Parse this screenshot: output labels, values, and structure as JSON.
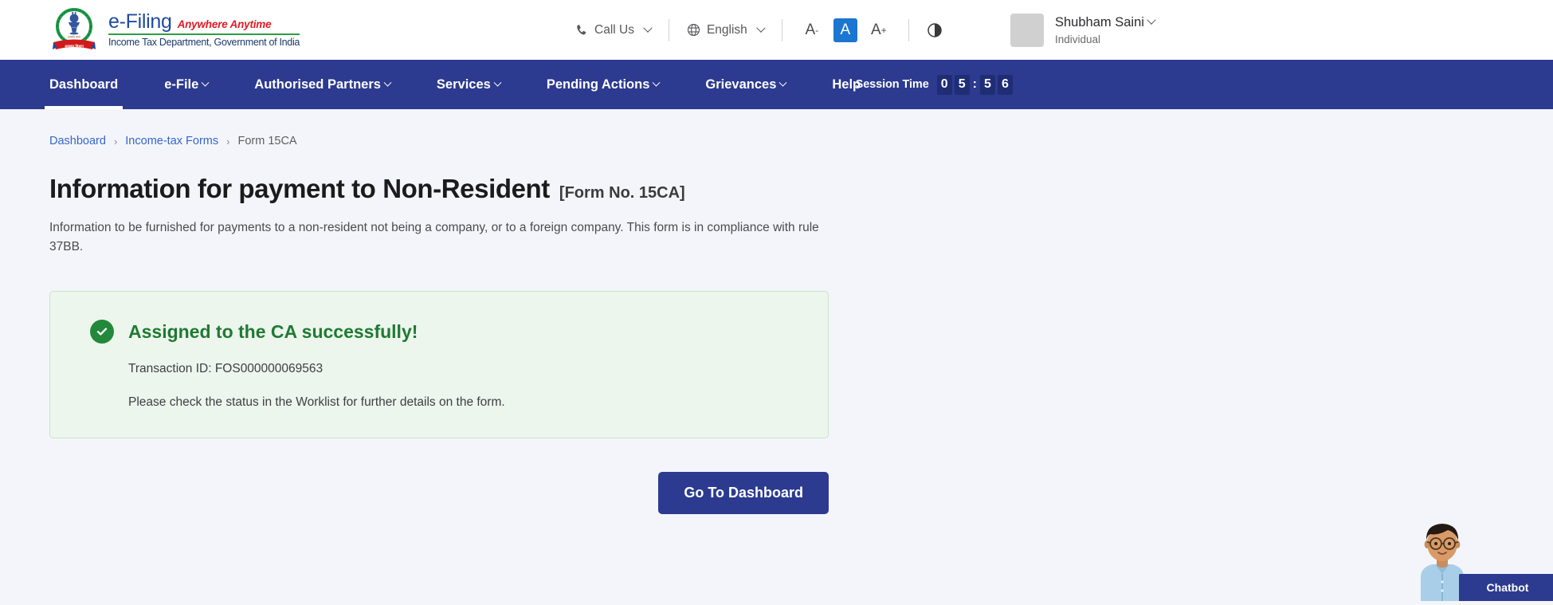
{
  "header": {
    "brand": {
      "emblem_alt": "india-emblem-income-tax",
      "title": "e-Filing",
      "tagline": "Anywhere Anytime",
      "department": "Income Tax Department, Government of India"
    },
    "tools": {
      "call_us": "Call Us",
      "language": "English",
      "font_decrease": "A",
      "font_decrease_sup": "-",
      "font_normal": "A",
      "font_increase": "A",
      "font_increase_sup": "+",
      "contrast_title": "contrast"
    },
    "user": {
      "name": "Shubham Saini",
      "role": "Individual"
    }
  },
  "nav": {
    "items": [
      {
        "label": "Dashboard",
        "has_caret": false,
        "active": true
      },
      {
        "label": "e-File",
        "has_caret": true,
        "active": false
      },
      {
        "label": "Authorised Partners",
        "has_caret": true,
        "active": false
      },
      {
        "label": "Services",
        "has_caret": true,
        "active": false
      },
      {
        "label": "Pending Actions",
        "has_caret": true,
        "active": false
      },
      {
        "label": "Grievances",
        "has_caret": true,
        "active": false
      },
      {
        "label": "Help",
        "has_caret": false,
        "active": false
      }
    ],
    "session": {
      "label": "Session Time",
      "d1": "0",
      "d2": "5",
      "colon": ":",
      "d3": "5",
      "d4": "6"
    }
  },
  "breadcrumb": {
    "item1": "Dashboard",
    "sep1": "›",
    "item2": "Income-tax Forms",
    "sep2": "›",
    "current": "Form 15CA"
  },
  "page": {
    "title": "Information for payment to Non-Resident",
    "form_no": "[Form No. 15CA]",
    "description": "Information to be furnished for payments to a non-resident not being a company, or to a foreign company. This form is in compliance with rule 37BB."
  },
  "success": {
    "title": "Assigned to the CA successfully!",
    "transaction_line": "Transaction ID: FOS000000069563",
    "status_line": "Please check the status in the Worklist for further details on the form."
  },
  "actions": {
    "go_to_dashboard": "Go To Dashboard"
  },
  "chatbot": {
    "label": "Chatbot"
  },
  "colors": {
    "nav_blue": "#2c3b8f",
    "accent_link": "#3366cc",
    "success_green": "#22883b",
    "success_bg": "#edf6ed",
    "success_border": "#c9e3c9",
    "page_bg": "#f4f5fa",
    "brand_blue": "#1f4ba0",
    "brand_red": "#e01b24",
    "brand_green": "#2f9e44",
    "fontsize_active": "#1b76d2"
  }
}
